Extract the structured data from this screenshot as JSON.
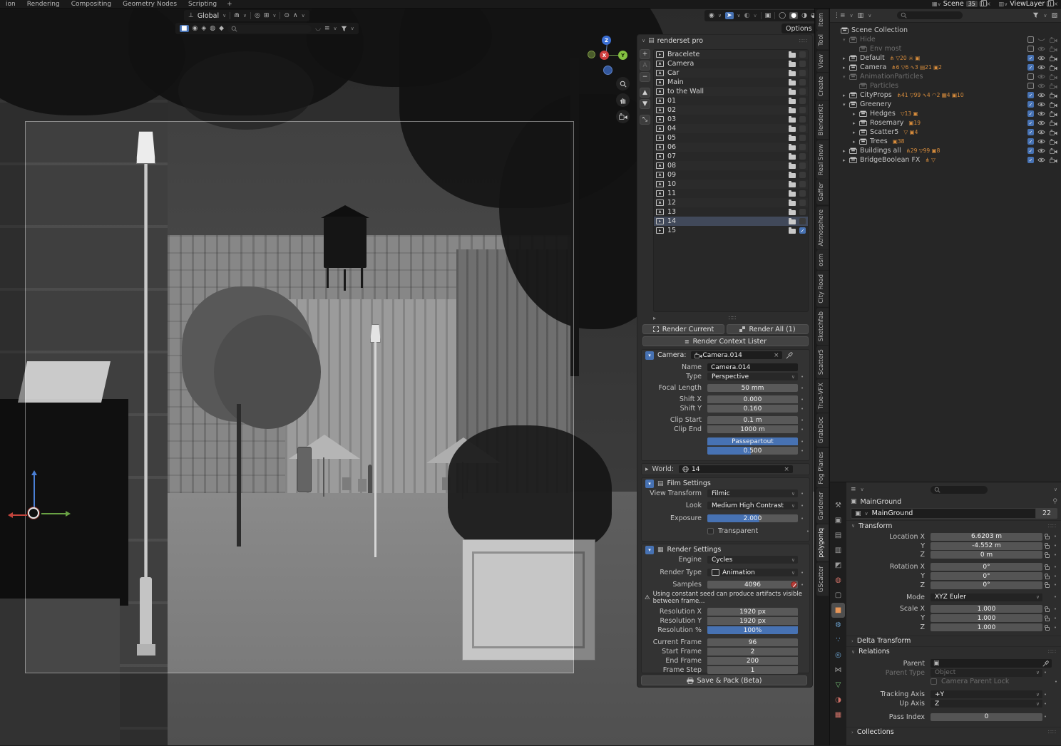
{
  "colors": {
    "accent": "#4772b3",
    "badge_orange": "#d98d3c"
  },
  "topbar": {
    "workspace_tabs": [
      {
        "label": "ion"
      },
      {
        "label": "Rendering"
      },
      {
        "label": "Compositing"
      },
      {
        "label": "Geometry Nodes"
      },
      {
        "label": "Scripting"
      }
    ],
    "add_tab": "+",
    "scene_label": "Scene",
    "scene_badge": "35",
    "viewlayer_label": "ViewLayer"
  },
  "viewport": {
    "orientation": "Global",
    "options_label": "Options",
    "axis": {
      "x": "X",
      "y": "Y",
      "z": "Z"
    }
  },
  "navtabs": [
    {
      "label": "Item"
    },
    {
      "label": "Tool"
    },
    {
      "label": "View"
    },
    {
      "label": "Create"
    },
    {
      "label": "BlenderKit"
    },
    {
      "label": "Real Snow"
    },
    {
      "label": "Gaffer"
    },
    {
      "label": "Atmosphere"
    },
    {
      "label": "osm"
    },
    {
      "label": "City Road"
    },
    {
      "label": "Sketchfab"
    },
    {
      "label": "Scatter5"
    },
    {
      "label": "True-VFX"
    },
    {
      "label": "GrabDoc"
    },
    {
      "label": "Fog Planes"
    },
    {
      "label": "Gardener"
    },
    {
      "label": "polygoniq",
      "state": "active"
    },
    {
      "label": "GScatter"
    }
  ],
  "renderset": {
    "title": "renderset pro",
    "list": [
      {
        "label": "Bracelete",
        "kind": "render"
      },
      {
        "label": "Camera",
        "kind": "image"
      },
      {
        "label": "Car",
        "kind": "image"
      },
      {
        "label": "Main",
        "kind": "image"
      },
      {
        "label": "to the Wall",
        "kind": "image"
      },
      {
        "label": "01",
        "kind": "image"
      },
      {
        "label": "02",
        "kind": "image"
      },
      {
        "label": "03",
        "kind": "image"
      },
      {
        "label": "04",
        "kind": "image"
      },
      {
        "label": "05",
        "kind": "image"
      },
      {
        "label": "06",
        "kind": "image"
      },
      {
        "label": "07",
        "kind": "image"
      },
      {
        "label": "08",
        "kind": "image"
      },
      {
        "label": "09",
        "kind": "image"
      },
      {
        "label": "10",
        "kind": "image"
      },
      {
        "label": "11",
        "kind": "image"
      },
      {
        "label": "12",
        "kind": "image"
      },
      {
        "label": "13",
        "kind": "image"
      },
      {
        "label": "14",
        "kind": "render",
        "state": "selected"
      },
      {
        "label": "15",
        "kind": "render",
        "checked": "true"
      }
    ],
    "render_current": "Render Current",
    "render_all": "Render All (1)",
    "context_lister": "Render Context Lister",
    "camera_label": "Camera:",
    "camera_value": "Camera.014",
    "fields": {
      "name_label": "Name",
      "name": "Camera.014",
      "type_label": "Type",
      "type": "Perspective",
      "focal_label": "Focal Length",
      "focal": "50 mm",
      "shiftx_label": "Shift X",
      "shiftx": "0.000",
      "shifty_label": "Shift Y",
      "shifty": "0.160",
      "clipstart_label": "Clip Start",
      "clipstart": "0.1 m",
      "clipend_label": "Clip End",
      "clipend": "1000 m",
      "passepartout": "Passepartout",
      "passe_value": "0.500"
    },
    "world_label": "World:",
    "world_value": "14",
    "film": {
      "title": "Film Settings",
      "vt_label": "View Transform",
      "vt": "Filmic",
      "look_label": "Look",
      "look": "Medium High Contrast",
      "exposure_label": "Exposure",
      "exposure": "2.000",
      "transparent": "Transparent"
    },
    "rs": {
      "title": "Render Settings",
      "engine_label": "Engine",
      "engine": "Cycles",
      "type_label": "Render Type",
      "type": "Animation",
      "samples_label": "Samples",
      "samples": "4096",
      "warning": "Using constant seed can produce artifacts visible between frame...",
      "resx_label": "Resolution X",
      "resx": "1920 px",
      "resy_label": "Resolution Y",
      "resy": "1920 px",
      "respct_label": "Resolution %",
      "respct": "100%",
      "cur_label": "Current Frame",
      "cur": "96",
      "start_label": "Start Frame",
      "start": "2",
      "end_label": "End Frame",
      "end": "200",
      "step_label": "Frame Step",
      "step": "1"
    },
    "save_pack": "Save & Pack (Beta)"
  },
  "outliner": {
    "rows": [
      {
        "label": "Scene Collection",
        "depth": "0",
        "checked": "none"
      },
      {
        "label": "Hide",
        "depth": "1",
        "arrow": "▾",
        "state": "disabled",
        "checked": "false",
        "eye": "closed"
      },
      {
        "label": "Env most",
        "depth": "2",
        "state": "disabled",
        "checked": "false"
      },
      {
        "label": "Default",
        "depth": "1",
        "arrow": "▸",
        "badges": "⋔ ▽20 ☠ ▣",
        "checked": "true"
      },
      {
        "label": "Camera",
        "depth": "1",
        "arrow": "▸",
        "badges": "⋔6 ▽6 ∿3 ▤21 ▣2",
        "checked": "true"
      },
      {
        "label": "AnimationParticles",
        "depth": "1",
        "arrow": "▾",
        "state": "disabled",
        "checked": "false"
      },
      {
        "label": "Particles",
        "depth": "2",
        "state": "disabled",
        "checked": "false"
      },
      {
        "label": "CityProps",
        "depth": "1",
        "arrow": "▸",
        "badges": "⋔41 ▽99 ∿4 ◠2 ▦4 ▣10",
        "checked": "true"
      },
      {
        "label": "Greenery",
        "depth": "1",
        "arrow": "▾",
        "checked": "true"
      },
      {
        "label": "Hedges",
        "depth": "2",
        "arrow": "▸",
        "badges": "▽13 ▣",
        "checked": "true"
      },
      {
        "label": "Rosemary",
        "depth": "2",
        "arrow": "▸",
        "badges": "▣19",
        "checked": "true"
      },
      {
        "label": "Scatter5",
        "depth": "2",
        "arrow": "▸",
        "badges": "▽ ▣4",
        "checked": "true"
      },
      {
        "label": "Trees",
        "depth": "2",
        "arrow": "▸",
        "badges": "▣38",
        "checked": "true"
      },
      {
        "label": "Buildings all",
        "depth": "1",
        "arrow": "▸",
        "badges": "⋔29 ▽99 ▣8",
        "checked": "true"
      },
      {
        "label": "BridgeBoolean FX",
        "depth": "1",
        "arrow": "▸",
        "badges": "⋔ ▽",
        "checked": "true"
      }
    ]
  },
  "properties": {
    "breadcrumb": "MainGround",
    "name": "MainGround",
    "users": "22",
    "tabs": [
      {
        "name": "properties-tab-tool",
        "glyph": "⚒",
        "tint": "gray"
      },
      {
        "name": "properties-tab-render",
        "glyph": "▣",
        "tint": "gray"
      },
      {
        "name": "properties-tab-output",
        "glyph": "▤",
        "tint": "gray"
      },
      {
        "name": "properties-tab-view-layer",
        "glyph": "▥",
        "tint": "gray"
      },
      {
        "name": "properties-tab-scene",
        "glyph": "◩",
        "tint": "gray"
      },
      {
        "name": "properties-tab-world",
        "glyph": "◍",
        "tint": "red"
      },
      {
        "name": "properties-tab-collection",
        "glyph": "▢",
        "tint": "gray"
      },
      {
        "name": "properties-tab-object",
        "glyph": "■",
        "tint": "orange",
        "state": "active"
      },
      {
        "name": "properties-tab-modifiers",
        "glyph": "⚙",
        "tint": "blue"
      },
      {
        "name": "properties-tab-particles",
        "glyph": "∵",
        "tint": "blue"
      },
      {
        "name": "properties-tab-physics",
        "glyph": "◎",
        "tint": "blue"
      },
      {
        "name": "properties-tab-constraints",
        "glyph": "⋈",
        "tint": "gray"
      },
      {
        "name": "properties-tab-object-data",
        "glyph": "▽",
        "tint": "green"
      },
      {
        "name": "properties-tab-material",
        "glyph": "◑",
        "tint": "red"
      },
      {
        "name": "properties-tab-texture",
        "glyph": "▦",
        "tint": "red"
      }
    ],
    "transform": {
      "title": "Transform",
      "rows": [
        {
          "label": "Location X",
          "value": "6.6203 m",
          "kind": "num"
        },
        {
          "label": "Y",
          "value": "-4.552 m",
          "kind": "num"
        },
        {
          "label": "Z",
          "value": "0 m",
          "kind": "num"
        },
        {
          "label": "Rotation X",
          "value": "0°",
          "kind": "num",
          "gap": "true"
        },
        {
          "label": "Y",
          "value": "0°",
          "kind": "num"
        },
        {
          "label": "Z",
          "value": "0°",
          "kind": "num"
        },
        {
          "label": "Mode",
          "value": "XYZ Euler",
          "kind": "drop",
          "gap": "true"
        },
        {
          "label": "Scale X",
          "value": "1.000",
          "kind": "num",
          "gap": "true"
        },
        {
          "label": "Y",
          "value": "1.000",
          "kind": "num"
        },
        {
          "label": "Z",
          "value": "1.000",
          "kind": "num"
        }
      ]
    },
    "delta": "Delta Transform",
    "relations": {
      "title": "Relations",
      "parent_label": "Parent",
      "parent_type_label": "Parent Type",
      "parent_type": "Object",
      "cam_lock": "Camera Parent Lock",
      "tracking_label": "Tracking Axis",
      "tracking": "+Y",
      "up_label": "Up Axis",
      "up": "Z",
      "pass_label": "Pass Index",
      "pass": "0"
    },
    "collections": "Collections"
  }
}
